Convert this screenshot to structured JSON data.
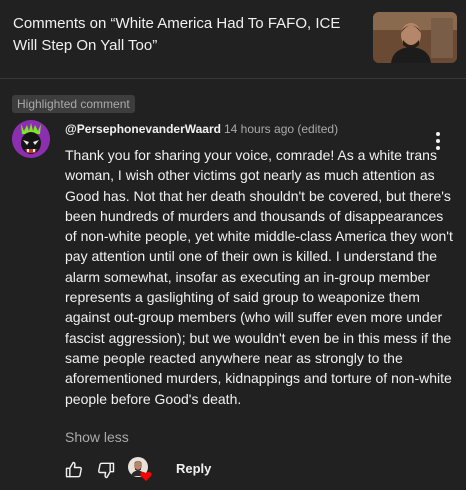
{
  "header": {
    "title": "Comments on “White America Had To FAFO, ICE Will Step On Yall Too”"
  },
  "comment": {
    "badge": "Highlighted comment",
    "author": "@PersephonevanderWaard",
    "time": "14 hours ago (edited)",
    "text": "Thank you for sharing your voice, comrade! As a white trans woman, I wish other victims got nearly as much attention as Good has. Not that her death shouldn't be covered, but there's been hundreds of murders and thousands of disappearances of non-white people, yet white middle-class America they won't pay attention until one of their own is killed. I understand the alarm somewhat, insofar as executing an in-group member represents a gaslighting of said group to weaponize them against out-group members (who will suffer even more under fascist aggression); but we wouldn't even be in this mess if the same people reacted anywhere near as strongly to the aforementioned murders, kidnappings and torture of non-white people before Good's death.",
    "show_less": "Show less",
    "reply": "Reply"
  },
  "colors": {
    "background": "#212121",
    "text": "#f1f1f1",
    "muted": "#aaaaaa",
    "heart": "#ff0000",
    "avatar": "#8b2fb0"
  },
  "icons": {
    "like": "thumbs-up-icon",
    "dislike": "thumbs-down-icon",
    "heart": "creator-heart-icon",
    "menu": "more-vert-icon"
  }
}
